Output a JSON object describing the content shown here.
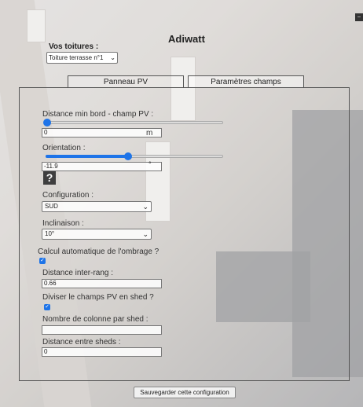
{
  "app": {
    "title": "Adiwatt"
  },
  "roof": {
    "label": "Vos toitures :",
    "selected": "Toiture terrasse n°1"
  },
  "tabs": [
    {
      "label": "Panneau PV",
      "active": false
    },
    {
      "label": "Paramètres champs",
      "active": true
    }
  ],
  "fields": {
    "distance_min": {
      "label": "Distance min bord - champ PV :",
      "value": "0",
      "unit": "m",
      "slider_level": 0.0
    },
    "orientation": {
      "label": "Orientation :",
      "value": "-11.9",
      "unit": "°",
      "slider_level": 0.45
    },
    "configuration": {
      "label": "Configuration :",
      "selected": "SUD"
    },
    "inclinaison": {
      "label": "Inclinaison :",
      "selected": "10°"
    },
    "auto_shading": {
      "label": "Calcul automatique de l'ombrage ?",
      "checked": true
    },
    "inter_rang": {
      "label": "Distance inter-rang :",
      "value": "0.66"
    },
    "shed": {
      "label": "Diviser le champs PV en shed ?",
      "checked": true
    },
    "colonnes": {
      "label": "Nombre de colonne par shed :",
      "value": ""
    },
    "entre_sheds": {
      "label": "Distance entre sheds :",
      "value": "0"
    }
  },
  "help_icon": "?",
  "save_button": "Sauvegarder cette configuration",
  "colors": {
    "accent": "#1e74e8",
    "border": "#555555"
  }
}
